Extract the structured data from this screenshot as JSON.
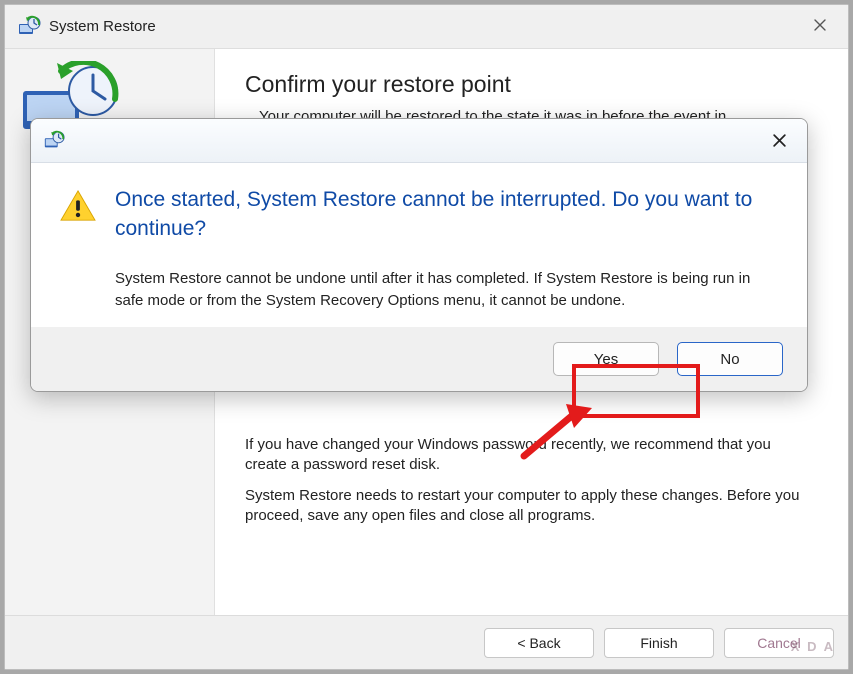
{
  "wizard": {
    "title": "System Restore",
    "heading": "Confirm your restore point",
    "subtext": "Your computer will be restored to the state it was in before the event in",
    "para1": "If you have changed your Windows password recently, we recommend that you create a password reset disk.",
    "para2": "System Restore needs to restart your computer to apply these changes. Before you proceed, save any open files and close all programs.",
    "footer": {
      "back": "< Back",
      "finish": "Finish",
      "cancel": "Cancel"
    }
  },
  "dialog": {
    "heading": "Once started, System Restore cannot be interrupted. Do you want to continue?",
    "body": "System Restore cannot be undone until after it has completed. If System Restore is being run in safe mode or from the System Recovery Options menu, it cannot be undone.",
    "yes": "Yes",
    "no": "No"
  },
  "annotation": {
    "highlight_color": "#e31b1b",
    "arrow_color": "#e31b1b"
  },
  "watermark": "X D A"
}
